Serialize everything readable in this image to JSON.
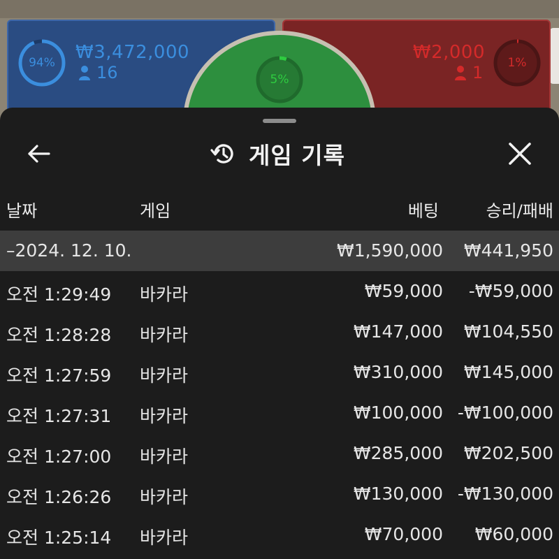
{
  "board": {
    "blue": {
      "percent_text": "94%",
      "percent": 94,
      "amount": "₩3,472,000",
      "players": "16",
      "color": "#3b8ede"
    },
    "green": {
      "percent_text": "5%",
      "percent": 5,
      "color": "#2ecc40"
    },
    "red": {
      "percent_text": "1%",
      "percent": 1,
      "amount": "₩2,000",
      "players": "1",
      "color": "#d42a2a"
    }
  },
  "sheet": {
    "title": "게임 기록",
    "icons": {
      "back": "back-arrow-icon",
      "history": "history-icon",
      "close": "close-icon"
    },
    "columns": {
      "date": "날짜",
      "game": "게임",
      "bet": "베팅",
      "result": "승리/패배"
    },
    "summary": {
      "date": "–2024. 12. 10.",
      "bet": "₩1,590,000",
      "result": "₩441,950"
    },
    "rows": [
      {
        "time": "오전 1:29:49",
        "game": "바카라",
        "bet": "₩59,000",
        "result": "-₩59,000"
      },
      {
        "time": "오전 1:28:28",
        "game": "바카라",
        "bet": "₩147,000",
        "result": "₩104,550"
      },
      {
        "time": "오전 1:27:59",
        "game": "바카라",
        "bet": "₩310,000",
        "result": "₩145,000"
      },
      {
        "time": "오전 1:27:31",
        "game": "바카라",
        "bet": "₩100,000",
        "result": "-₩100,000"
      },
      {
        "time": "오전 1:27:00",
        "game": "바카라",
        "bet": "₩285,000",
        "result": "₩202,500"
      },
      {
        "time": "오전 1:26:26",
        "game": "바카라",
        "bet": "₩130,000",
        "result": "-₩130,000"
      },
      {
        "time": "오전 1:25:14",
        "game": "바카라",
        "bet": "₩70,000",
        "result": "₩60,000"
      }
    ]
  }
}
